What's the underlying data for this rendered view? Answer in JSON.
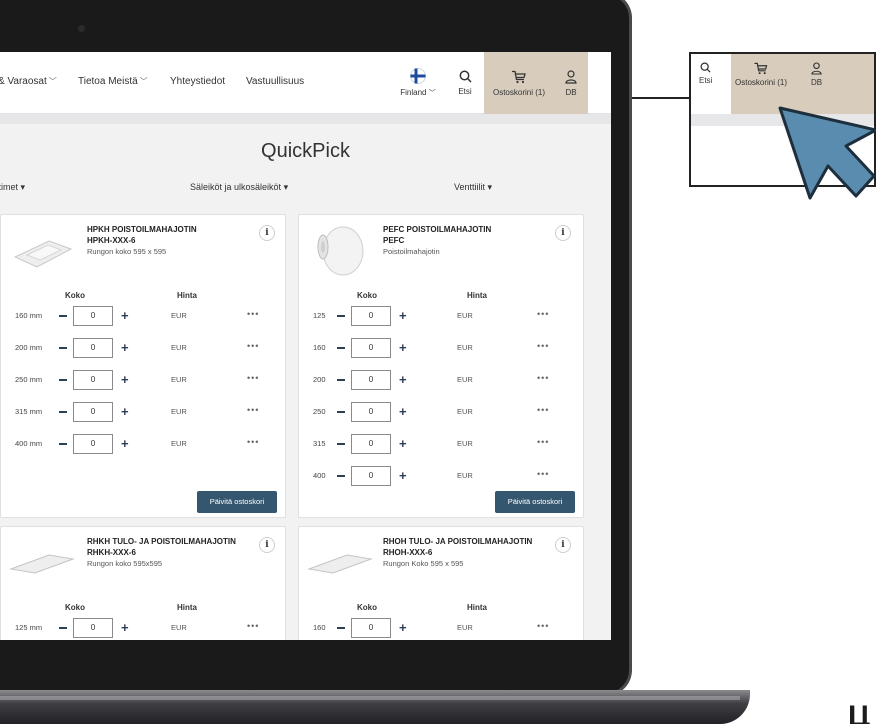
{
  "nav": {
    "links": [
      "& Varaosat",
      "Tietoa Meistä",
      "Yhteystiedot",
      "Vastuullisuus"
    ],
    "region": "Finland",
    "search_label": "Etsi",
    "cart_label": "Ostoskorini (1)",
    "user_label": "DB"
  },
  "page": {
    "title": "QuickPick",
    "filters": [
      "ttimet",
      "Säleiköt ja ulkosäleiköt",
      "Venttiilit"
    ]
  },
  "table_headers": {
    "size": "Koko",
    "price": "Hinta"
  },
  "currency": "EUR",
  "update_label": "Päivitä ostoskori",
  "products": [
    {
      "title": "HPKH POISTOILMAHAJOTIN",
      "code": "HPKH-XXX-6",
      "subtitle": "Rungon koko 595 x 595",
      "rows": [
        {
          "size": "160 mm",
          "qty": "0"
        },
        {
          "size": "200 mm",
          "qty": "0"
        },
        {
          "size": "250 mm",
          "qty": "0"
        },
        {
          "size": "315 mm",
          "qty": "0"
        },
        {
          "size": "400 mm",
          "qty": "0"
        }
      ]
    },
    {
      "title": "PEFC POISTOILMAHAJOTIN",
      "code": "PEFC",
      "subtitle": "Poistoilmahajotin",
      "rows": [
        {
          "size": "125",
          "qty": "0"
        },
        {
          "size": "160",
          "qty": "0"
        },
        {
          "size": "200",
          "qty": "0"
        },
        {
          "size": "250",
          "qty": "0"
        },
        {
          "size": "315",
          "qty": "0"
        },
        {
          "size": "400",
          "qty": "0"
        }
      ]
    },
    {
      "title": "RHKH TULO- JA POISTOILMAHAJOTIN",
      "code": "RHKH-XXX-6",
      "subtitle": "Rungon koko 595x595",
      "rows": [
        {
          "size": "125 mm",
          "qty": "0"
        }
      ]
    },
    {
      "title": "RHOH TULO- JA POISTOILMAHAJOTIN",
      "code": "RHOH-XXX-6",
      "subtitle": "Rungon Koko 595 x 595",
      "rows": [
        {
          "size": "160",
          "qty": "0"
        }
      ]
    }
  ],
  "callout": {
    "search_label": "Etsi",
    "cart_label": "Ostoskorini (1)",
    "user_label": "DB"
  },
  "colors": {
    "cart_bg": "#d8cdbd",
    "button_bg": "#35566f",
    "arrow": "#5a8cb0"
  }
}
